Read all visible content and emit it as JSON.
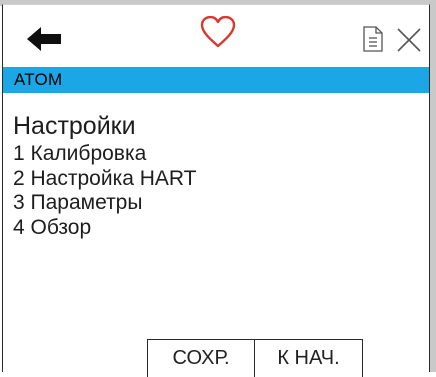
{
  "toolbar": {
    "back_icon": "arrow-left-icon",
    "favorite_icon": "heart-outline-icon",
    "document_icon": "document-icon",
    "close_icon": "close-icon",
    "favorite_color": "#d9382f"
  },
  "device_bar": {
    "name": "ATOM",
    "color": "#1ba6e5"
  },
  "menu": {
    "title": "Настройки",
    "items": [
      {
        "label": "1 Калибровка"
      },
      {
        "label": "2 Настройка HART"
      },
      {
        "label": "3 Параметры"
      },
      {
        "label": "4 Обзор"
      }
    ]
  },
  "buttons": {
    "save_label": "СОХР.",
    "home_label": "К НАЧ."
  }
}
